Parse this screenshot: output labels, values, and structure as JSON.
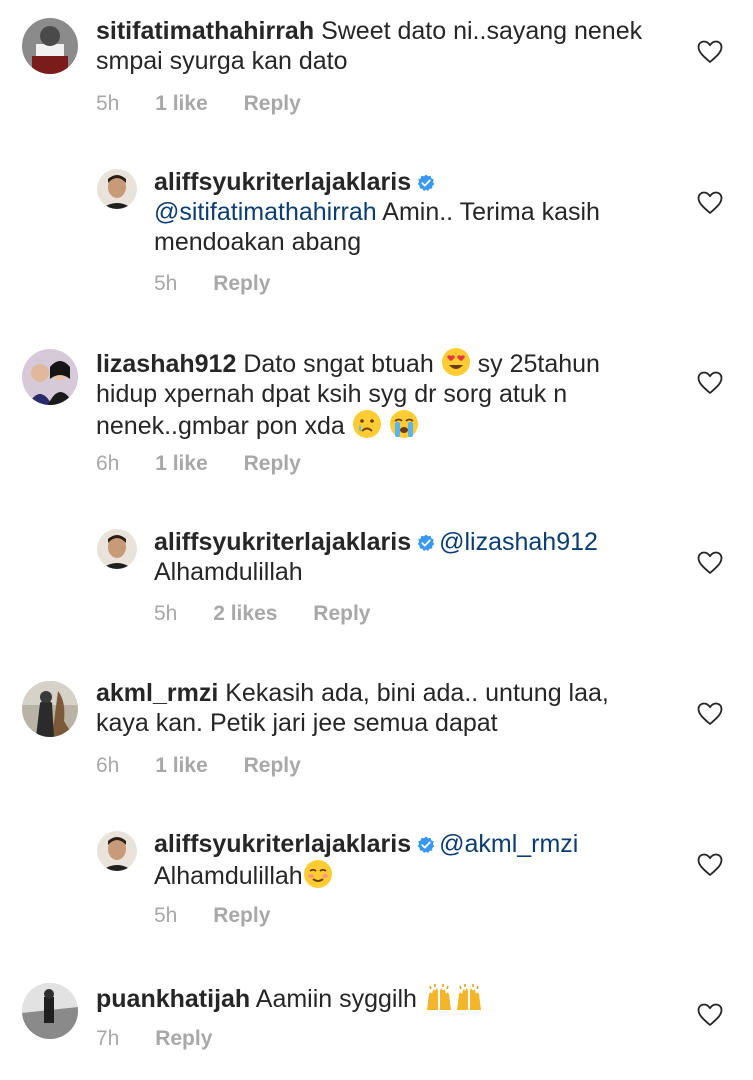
{
  "comments": [
    {
      "user": "sitifatimathahirrah",
      "text": "Sweet dato ni..sayang nenek smpai syurga  kan dato",
      "time": "5h",
      "likes": "1 like",
      "reply": "Reply"
    },
    {
      "user": "aliffsyukriterlajaklaris",
      "mention": "@sitifatimathahirrah",
      "text": "Amin.. Terima kasih mendoakan abang",
      "time": "5h",
      "reply": "Reply"
    },
    {
      "user": "lizashah912",
      "text_a": "Dato sngat btuah",
      "text_b": "sy 25tahun hidup xpernah dpat ksih syg dr sorg atuk n nenek..gmbar pon xda",
      "time": "6h",
      "likes": "1 like",
      "reply": "Reply"
    },
    {
      "user": "aliffsyukriterlajaklaris",
      "mention": "@lizashah912",
      "text": "Alhamdulillah",
      "time": "5h",
      "likes": "2 likes",
      "reply": "Reply"
    },
    {
      "user": "akml_rmzi",
      "text": "Kekasih ada, bini ada.. untung laa, kaya kan. Petik jari jee semua dapat",
      "time": "6h",
      "likes": "1 like",
      "reply": "Reply"
    },
    {
      "user": "aliffsyukriterlajaklaris",
      "mention": "@akml_rmzi",
      "text": "Alhamdulillah",
      "time": "5h",
      "reply": "Reply"
    },
    {
      "user": "puankhatijah",
      "text": "Aamiin  syggilh",
      "time": "7h",
      "reply": "Reply"
    }
  ],
  "icons": {
    "heart": "heart-outline-icon",
    "verified": "verified-badge-icon"
  },
  "colors": {
    "text": "#262626",
    "meta": "#a8a8a8",
    "mention": "#0a3d74",
    "verified": "#3897f0"
  }
}
